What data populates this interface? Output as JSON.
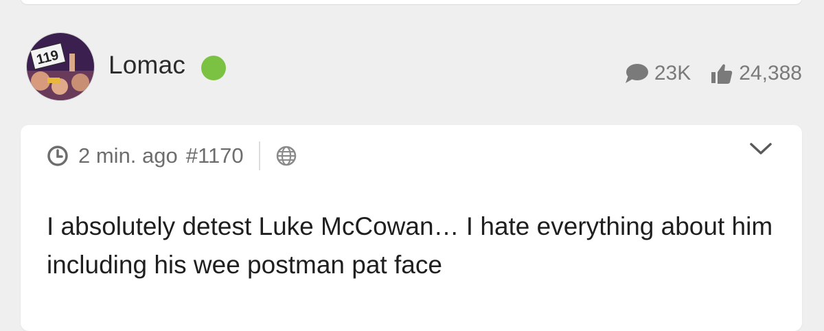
{
  "author": {
    "username": "Lomac",
    "online": true,
    "avatar_sign_text": "119",
    "post_count": "23K",
    "likes": "24,388"
  },
  "post": {
    "time_ago": "2 min. ago",
    "post_number": "#1170",
    "body": "I absolutely detest Luke McCowan… I hate everything about him including his wee postman pat face"
  },
  "colors": {
    "online": "#7cc242",
    "meta_text": "#6d6d6d",
    "background": "#efefef"
  },
  "icons": {
    "comments": "speech-bubble-icon",
    "likes": "thumbs-up-icon",
    "time": "clock-icon",
    "visibility": "globe-icon",
    "expand": "chevron-down-icon"
  }
}
